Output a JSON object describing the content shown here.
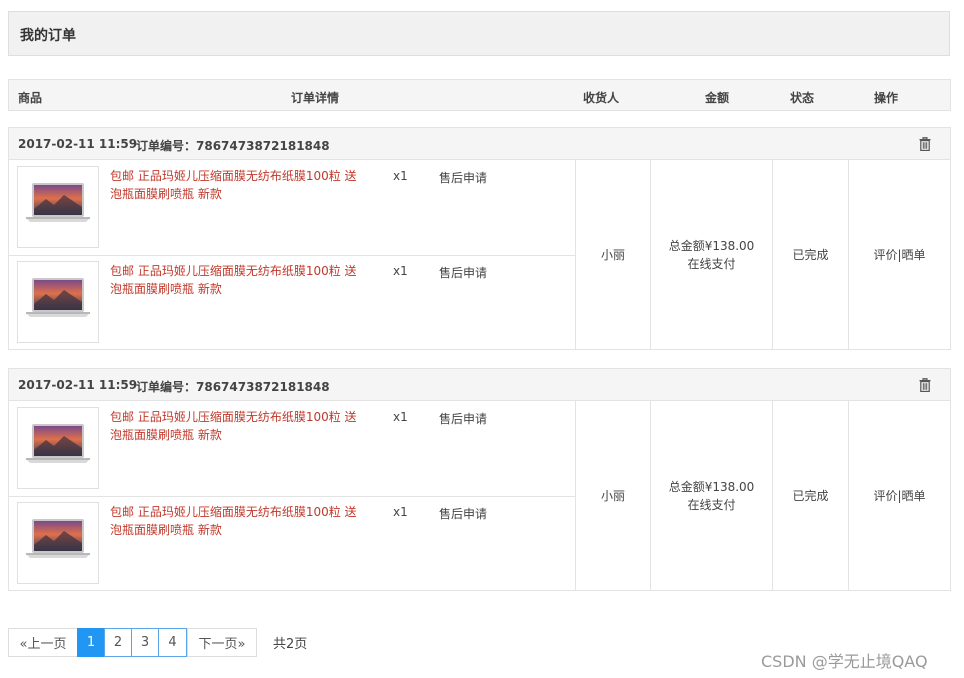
{
  "page_title": "我的订单",
  "columns": {
    "product": "商品",
    "detail": "订单详情",
    "receiver": "收货人",
    "amount": "金额",
    "status": "状态",
    "action": "操作"
  },
  "orders": [
    {
      "date": "2017-02-11 11:59",
      "order_no": "订单编号：7867473872181848",
      "items": [
        {
          "name": "包邮 正品玛姬儿压缩面膜无纺布纸膜100粒 送泡瓶面膜刷喷瓶 新款",
          "qty": "x1",
          "after_sale": "售后申请"
        },
        {
          "name": "包邮 正品玛姬儿压缩面膜无纺布纸膜100粒 送泡瓶面膜刷喷瓶 新款",
          "qty": "x1",
          "after_sale": "售后申请"
        }
      ],
      "receiver": "小丽",
      "amount_line1": "总金额¥138.00",
      "amount_line2": "在线支付",
      "status": "已完成",
      "action_review": "评价",
      "action_sep": "|",
      "action_share": "晒单"
    },
    {
      "date": "2017-02-11 11:59",
      "order_no": "订单编号：7867473872181848",
      "items": [
        {
          "name": "包邮 正品玛姬儿压缩面膜无纺布纸膜100粒 送泡瓶面膜刷喷瓶 新款",
          "qty": "x1",
          "after_sale": "售后申请"
        },
        {
          "name": "包邮 正品玛姬儿压缩面膜无纺布纸膜100粒 送泡瓶面膜刷喷瓶 新款",
          "qty": "x1",
          "after_sale": "售后申请"
        }
      ],
      "receiver": "小丽",
      "amount_line1": "总金额¥138.00",
      "amount_line2": "在线支付",
      "status": "已完成",
      "action_review": "评价",
      "action_sep": "|",
      "action_share": "晒单"
    }
  ],
  "pagination": {
    "prev": "«上一页",
    "pages": [
      "1",
      "2",
      "3",
      "4"
    ],
    "active_page": "1",
    "next": "下一页»",
    "total": "共2页"
  },
  "watermark": "CSDN @学无止境QAQ",
  "colors": {
    "accent": "#2196f3",
    "product_link": "#c0392b",
    "header_bg": "#f5f5f5"
  }
}
